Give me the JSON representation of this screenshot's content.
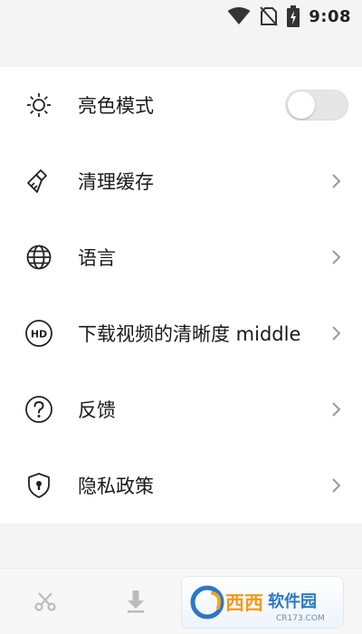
{
  "status_bar": {
    "time": "9:08",
    "icons": [
      "wifi-icon",
      "no-sim-icon",
      "battery-charging-icon"
    ]
  },
  "settings": {
    "items": [
      {
        "icon": "sun-icon",
        "label": "亮色模式",
        "control": "toggle",
        "toggle_on": false
      },
      {
        "icon": "brush-icon",
        "label": "清理缓存",
        "control": "chevron"
      },
      {
        "icon": "globe-icon",
        "label": "语言",
        "control": "chevron"
      },
      {
        "icon": "hd-icon",
        "label": "下载视频的清晰度 middle",
        "control": "chevron"
      },
      {
        "icon": "help-icon",
        "label": "反馈",
        "control": "chevron"
      },
      {
        "icon": "shield-icon",
        "label": "隐私政策",
        "control": "chevron"
      }
    ]
  },
  "bottom_nav": {
    "items": [
      "scissors-icon",
      "download-icon"
    ]
  },
  "watermark": {
    "logo": "cr173-logo",
    "text": "西西软件园",
    "subtext": "CR173.COM"
  },
  "colors": {
    "background": "#f4f4f4",
    "card": "#ffffff",
    "icon": "#222222",
    "chevron": "#9a9a9a",
    "toggle_track": "#e6e6e6",
    "nav_icon": "#bbbbbb"
  }
}
